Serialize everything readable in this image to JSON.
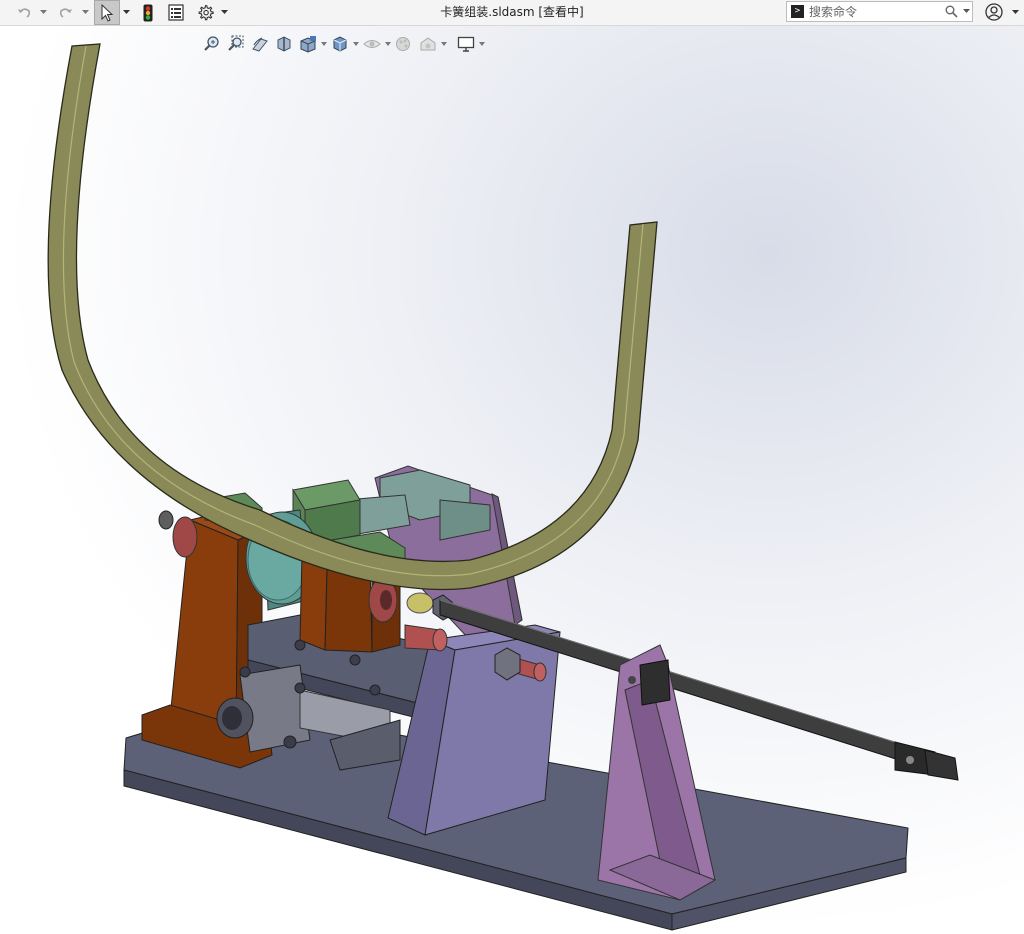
{
  "window": {
    "title": "卡簧组装.sldasm [查看中]"
  },
  "toolbar": {
    "undo_icon": "undo-icon",
    "redo_icon": "redo-icon",
    "select_icon": "select-arrow-icon",
    "rebuild_icon": "traffic-light-icon",
    "file_props_icon": "file-properties-icon",
    "options_icon": "gear-icon"
  },
  "search": {
    "placeholder": "搜索命令"
  },
  "heads_up_toolbar": {
    "items": [
      "zoom-to-fit-icon",
      "zoom-to-area-icon",
      "previous-view-icon",
      "section-view-icon",
      "view-orientation-icon",
      "display-style-icon",
      "hide-show-items-icon",
      "edit-appearance-icon",
      "apply-scene-icon",
      "view-settings-icon"
    ]
  },
  "colors": {
    "toolbar_bg": "#f4f4f4",
    "spring_steel": "#8a8a5a",
    "base_plate": "#5e6278",
    "orange_block": "#8a3d0c",
    "purple_plate": "#8a6f9a",
    "teal_cylinder": "#5a9690",
    "green_clamp": "#5e8a5a",
    "rod_dark": "#3a3a3a",
    "red_parts": "#a44a4a"
  }
}
